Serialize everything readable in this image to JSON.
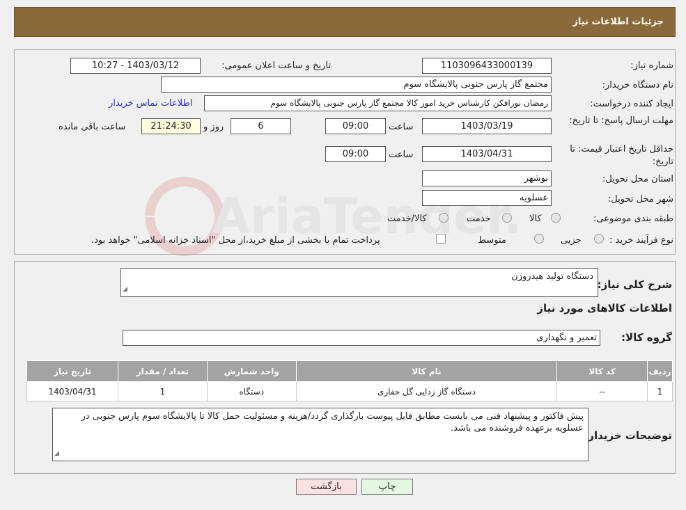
{
  "header": {
    "title": "جزئیات اطلاعات نیاز"
  },
  "fields": {
    "need_number_label": "شماره نیاز:",
    "need_number": "1103096433000139",
    "announce_label": "تاریخ و ساعت اعلان عمومی:",
    "announce_value": "1403/03/12 - 10:27",
    "buyer_org_label": "نام دستگاه خریدار:",
    "buyer_org": "مجتمع گاز پارس جنوبی  پالایشگاه سوم",
    "creator_label": "ایجاد کننده درخواست:",
    "creator": "رمضان نورافکن کارشناس خرید امور کالا مجتمع گاز پارس جنوبی  پالایشگاه سوم",
    "contact_link": "اطلاعات تماس خریدار",
    "deadline_label": "مهلت ارسال پاسخ: تا تاریخ:",
    "deadline_date": "1403/03/19",
    "time_label": "ساعت",
    "deadline_time": "09:00",
    "days_value": "6",
    "days_label": "روز و",
    "remaining_time": "21:24:30",
    "remaining_label": "ساعت باقی مانده",
    "validity_label": "حداقل تاریخ اعتبار قیمت: تا تاریخ:",
    "validity_date": "1403/04/31",
    "validity_time": "09:00",
    "province_label": "استان محل تحویل:",
    "province": "بوشهر",
    "city_label": "شهر محل تحویل:",
    "city": "عسلویه",
    "category_label": "طبقه بندی موضوعی:",
    "category_options": [
      "کالا",
      "خدمت",
      "کالا/خدمت"
    ],
    "process_label": "نوع فرآیند خرید :",
    "process_options": [
      "جزیی",
      "متوسط"
    ],
    "payment_note": "پرداخت تمام یا بخشی از مبلغ خرید،از محل \"اسناد خزانه اسلامی\" خواهد بود."
  },
  "description": {
    "label": "شرح کلی نیاز:",
    "value": "دستگاه تولید هیدروژن",
    "goods_title": "اطلاعات کالاهای مورد نیاز",
    "group_label": "گروه کالا:",
    "group_value": "تعمیر و نگهداری"
  },
  "table": {
    "headers": [
      "ردیف",
      "کد کالا",
      "نام کالا",
      "واحد شمارش",
      "تعداد / مقدار",
      "تاریخ نیاز"
    ],
    "rows": [
      [
        "1",
        "--",
        "دستگاه گاز زدایی گل حفاری",
        "دستگاه",
        "1",
        "1403/04/31"
      ]
    ]
  },
  "buyer_notes": {
    "label": "توضیحات خریدار:",
    "value": "پیش فاکتور و پیشنهاد فنی می بایست مطابق فایل پیوست بارگذاری گردد/هزینه و مسئولیت حمل کالا تا پالایشگاه سوم پارس جنوبی در عسلویه برعهده فروشنده می باشد."
  },
  "buttons": {
    "print": "چاپ",
    "back": "بازگشت"
  },
  "watermark": {
    "text": "AriaTender.neT"
  },
  "colors": {
    "header_bg": "#8a6a3b",
    "table_header_bg": "#a3a3a3",
    "print_btn_bg": "#e3f7e1",
    "back_btn_bg": "#fbe2e2",
    "link": "#2a2ad0"
  }
}
